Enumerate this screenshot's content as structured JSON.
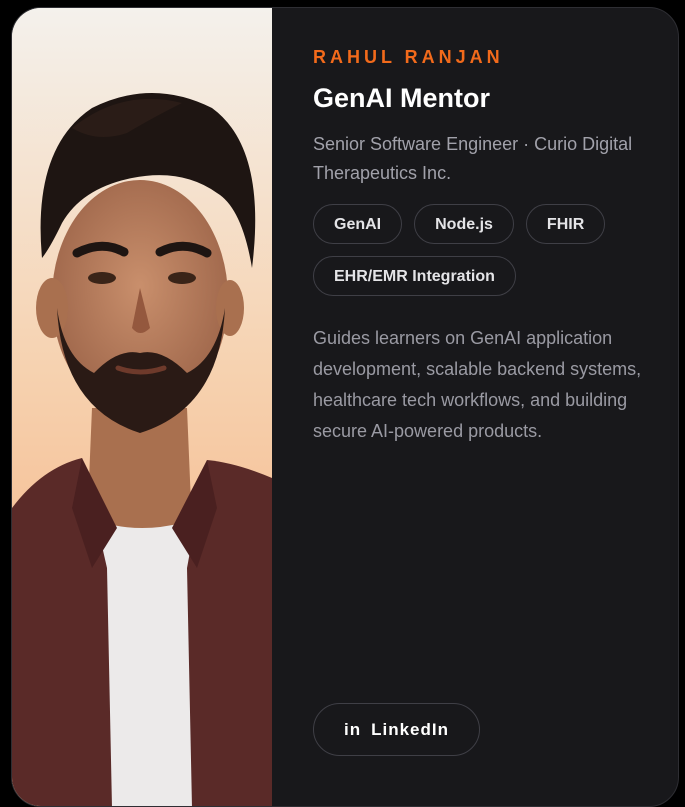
{
  "mentor": {
    "name": "RAHUL RANJAN",
    "role": "GenAI Mentor",
    "position": "Senior Software Engineer · Curio Digital Therapeutics Inc.",
    "tags": [
      "GenAI",
      "Node.js",
      "FHIR",
      "EHR/EMR Integration"
    ],
    "description": "Guides learners on GenAI application development, scalable backend systems, healthcare tech workflows, and building secure AI-powered products."
  },
  "actions": {
    "linkedin_icon": "in",
    "linkedin_label": "LinkedIn"
  },
  "colors": {
    "accent": "#f26a1b",
    "card_bg": "#18181b",
    "border": "#3f3f46"
  }
}
